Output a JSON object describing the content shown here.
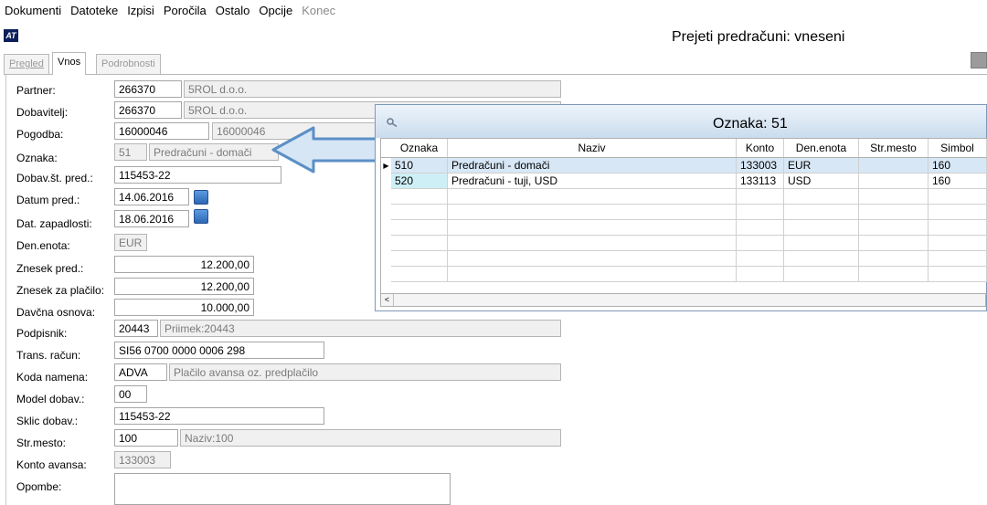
{
  "menu": {
    "items": [
      "Dokumenti",
      "Datoteke",
      "Izpisi",
      "Poročila",
      "Ostalo",
      "Opcije"
    ],
    "disabled_item": "Konec"
  },
  "app": {
    "logo_text": "AT",
    "title": "Prejeti predračuni: vneseni"
  },
  "tabs": [
    {
      "label": "Pregled",
      "active": false
    },
    {
      "label": "Vnos",
      "active": true
    },
    {
      "label": "Podrobnosti",
      "active": false
    }
  ],
  "form": {
    "partner": {
      "label": "Partner:",
      "code": "266370",
      "name": "5ROL d.o.o."
    },
    "dobavitelj": {
      "label": "Dobavitelj:",
      "code": "266370",
      "name": "5ROL d.o.o."
    },
    "pogodba": {
      "label": "Pogodba:",
      "value": "16000046",
      "value2": "16000046"
    },
    "oznaka": {
      "label": "Oznaka:",
      "code": "51",
      "name": "Predračuni - domači"
    },
    "dobav_st_pred": {
      "label": "Dobav.št. pred.:",
      "value": "115453-22"
    },
    "datum_pred": {
      "label": "Datum pred.:",
      "value": "14.06.2016"
    },
    "dat_zapadlosti": {
      "label": "Dat. zapadlosti:",
      "value": "18.06.2016"
    },
    "den_enota": {
      "label": "Den.enota:",
      "value": "EUR"
    },
    "znesek_pred": {
      "label": "Znesek pred.:",
      "value": "12.200,00"
    },
    "znesek_za_placilo": {
      "label": "Znesek za plačilo:",
      "value": "12.200,00"
    },
    "davcna_osnova": {
      "label": "Davčna osnova:",
      "value": "10.000,00"
    },
    "podpisnik": {
      "label": "Podpisnik:",
      "code": "20443",
      "name": "Priimek:20443"
    },
    "trans_racun": {
      "label": "Trans. račun:",
      "value": "SI56 0700 0000 0006 298"
    },
    "koda_namena": {
      "label": "Koda namena:",
      "code": "ADVA",
      "name": "Plačilo avansa oz. predplačilo"
    },
    "model_dobav": {
      "label": "Model dobav.:",
      "value": "00"
    },
    "sklic_dobav": {
      "label": "Sklic dobav.:",
      "value": "115453-22"
    },
    "str_mesto": {
      "label": "Str.mesto:",
      "code": "100",
      "name": "Naziv:100"
    },
    "konto_avansa": {
      "label": "Konto avansa:",
      "value": "133003"
    },
    "opombe": {
      "label": "Opombe:",
      "value": ""
    }
  },
  "lookup": {
    "title": "Oznaka:  51",
    "columns": [
      "Oznaka",
      "Naziv",
      "Konto",
      "Den.enota",
      "Str.mesto",
      "Simbol"
    ],
    "rows": [
      {
        "oznaka": "510",
        "naziv": "Predračuni - domači",
        "konto": "133003",
        "den_enota": "EUR",
        "str_mesto": "",
        "simbol": "160"
      },
      {
        "oznaka": "520",
        "naziv": "Predračuni - tuji, USD",
        "konto": "133113",
        "den_enota": "USD",
        "str_mesto": "",
        "simbol": "160"
      }
    ],
    "scroll_left": "<"
  },
  "colors": {
    "arrow_fill": "#d6e6f5",
    "arrow_stroke": "#5c8fc6",
    "selection": "#d7e7f6"
  }
}
